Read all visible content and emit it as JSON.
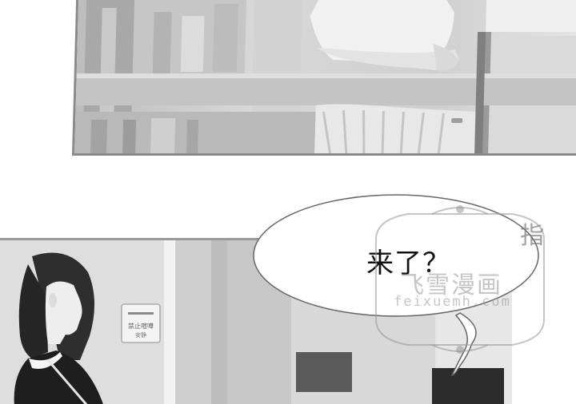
{
  "speech_bubble": {
    "text": "来了？"
  },
  "watermark": {
    "title": "飞雪漫画",
    "url": "feixuemh.com",
    "side_text": "指"
  },
  "sign": {
    "line1": "——",
    "line2": "禁止喧嘩",
    "line3": "安静"
  }
}
